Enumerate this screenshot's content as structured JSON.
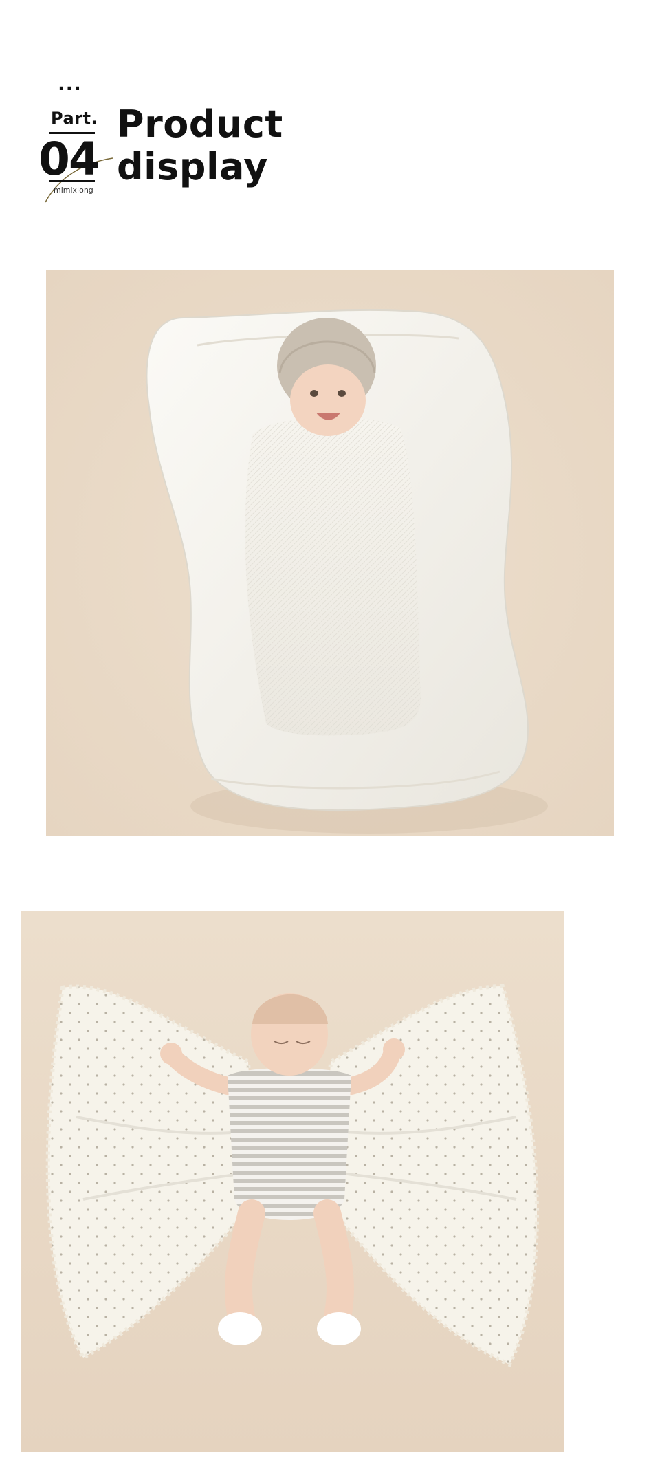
{
  "header": {
    "dots": "...",
    "part_label": "Part.",
    "part_number": "04",
    "brand": "mimixiong",
    "title_line1": "Product",
    "title_line2": "display"
  },
  "photos": [
    {
      "subject": "baby swaddled in knit blanket lying in white lounger pillow"
    },
    {
      "subject": "sleeping baby in striped bodysuit on spread knit blanket"
    }
  ],
  "colors": {
    "backdrop": "#eadbc9",
    "text": "#111111",
    "cream": "#f3efe6"
  }
}
